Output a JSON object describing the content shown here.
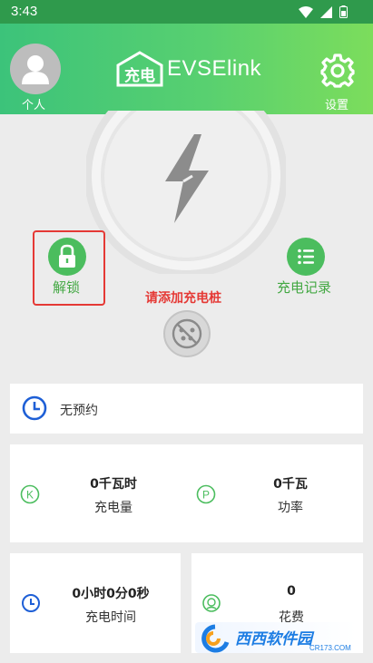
{
  "status_bar": {
    "time": "3:43"
  },
  "header": {
    "profile_label": "个人",
    "logo_mark": "充电",
    "logo_text": "EVSElink",
    "settings_label": "设置"
  },
  "actions": {
    "unlock_label": "解锁",
    "records_label": "充电记录",
    "add_charger_text": "请添加充电桩"
  },
  "reservation": {
    "text": "无预约"
  },
  "stats": {
    "energy": {
      "value": "0千瓦时",
      "label": "充电量"
    },
    "power": {
      "value": "0千瓦",
      "label": "功率"
    },
    "duration": {
      "value": "0小时0分0秒",
      "label": "充电时间"
    },
    "cost": {
      "value": "0",
      "label": "花费"
    }
  },
  "watermark": {
    "text": "西西软件园",
    "sub": "CR173.COM"
  },
  "colors": {
    "accent_green": "#4bbd5e",
    "alert_red": "#e53935",
    "clock_blue": "#1e5fd6"
  },
  "icons": [
    "wifi-icon",
    "signal-icon",
    "battery-icon",
    "avatar-icon",
    "gear-icon",
    "bolt-icon",
    "lock-icon",
    "list-icon",
    "plug-icon",
    "clock-icon",
    "k-icon",
    "p-icon",
    "coin-icon"
  ]
}
